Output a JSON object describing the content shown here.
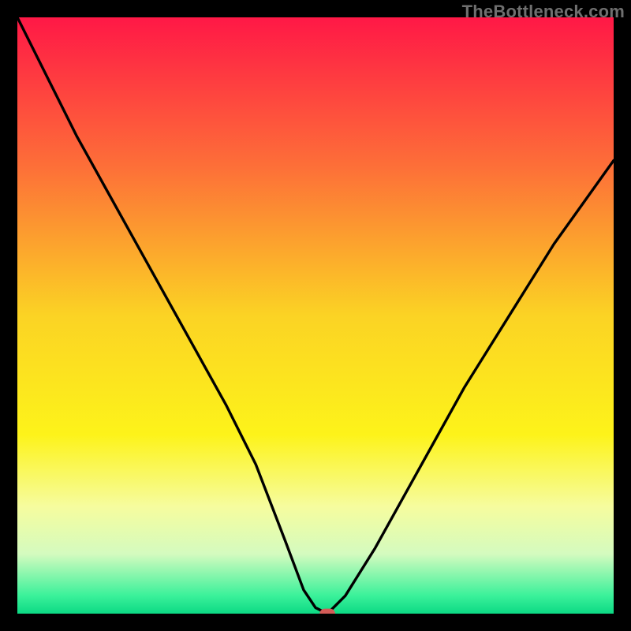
{
  "watermark": "TheBottleneck.com",
  "chart_data": {
    "type": "line",
    "title": "",
    "xlabel": "",
    "ylabel": "",
    "xlim": [
      0,
      100
    ],
    "ylim": [
      0,
      100
    ],
    "grid": false,
    "background_gradient": [
      {
        "stop": 0.0,
        "color": "#ff1846"
      },
      {
        "stop": 0.25,
        "color": "#fd6f38"
      },
      {
        "stop": 0.5,
        "color": "#fbd324"
      },
      {
        "stop": 0.7,
        "color": "#fdf31a"
      },
      {
        "stop": 0.82,
        "color": "#f6fc9e"
      },
      {
        "stop": 0.9,
        "color": "#d4fbbf"
      },
      {
        "stop": 0.97,
        "color": "#3af19a"
      },
      {
        "stop": 1.0,
        "color": "#0cd984"
      }
    ],
    "series": [
      {
        "name": "bottleneck-curve",
        "color": "#000000",
        "x": [
          0,
          5,
          10,
          15,
          20,
          25,
          30,
          35,
          40,
          45,
          48,
          50,
          52,
          55,
          60,
          65,
          70,
          75,
          80,
          85,
          90,
          95,
          100
        ],
        "y": [
          100,
          90,
          80,
          71,
          62,
          53,
          44,
          35,
          25,
          12,
          4,
          1,
          0,
          3,
          11,
          20,
          29,
          38,
          46,
          54,
          62,
          69,
          76
        ]
      }
    ],
    "marker": {
      "name": "optimum-marker",
      "shape": "pill",
      "color": "#d35b57",
      "x": 52,
      "y": 0,
      "width_pct": 2.6,
      "height_pct": 1.7
    }
  }
}
